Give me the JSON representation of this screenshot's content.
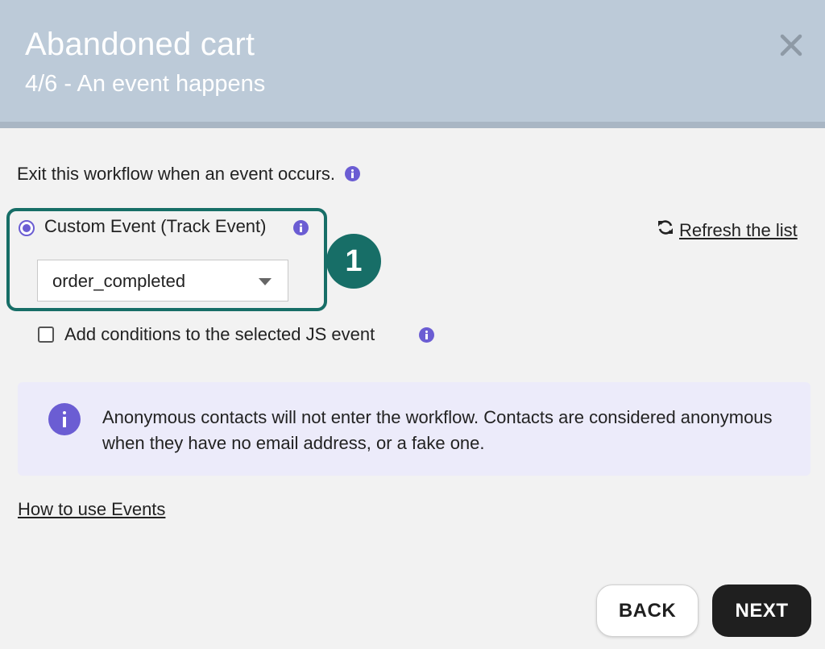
{
  "header": {
    "title": "Abandoned cart",
    "subtitle": "4/6 - An event happens",
    "close_icon": "close-icon"
  },
  "intro": {
    "text": "Exit this workflow when an event occurs.",
    "icon": "info-icon"
  },
  "event_option": {
    "label": "Custom Event (Track Event)",
    "selected": true,
    "icon": "info-icon",
    "select_value": "order_completed",
    "select_icon": "chevron-down-icon"
  },
  "step_badge": "1",
  "refresh": {
    "label": "Refresh the list",
    "icon": "refresh-icon"
  },
  "conditions": {
    "label": "Add conditions to the selected JS event",
    "checked": false,
    "icon": "info-icon"
  },
  "notice": {
    "text": "Anonymous contacts will not enter the workflow. Contacts are considered anonymous when they have no email address, or a fake one.",
    "icon": "info-icon"
  },
  "help_link": "How to use Events",
  "buttons": {
    "back": "BACK",
    "next": "NEXT"
  },
  "colors": {
    "header_bg": "#bccad8",
    "accent": "#6b5dd3",
    "highlight": "#176e67",
    "notice_bg": "#ecebfa",
    "primary_button": "#1f1f1f"
  }
}
